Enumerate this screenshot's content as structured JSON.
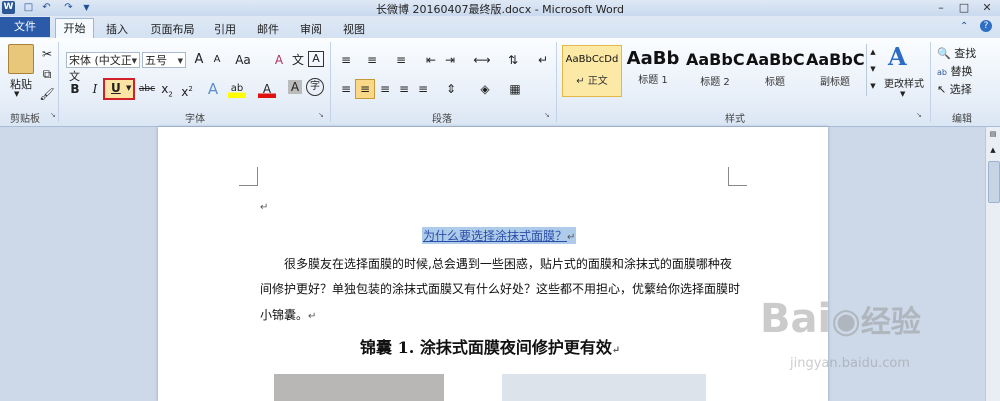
{
  "title_bar": {
    "title": "长微博 20160407最终版.docx - Microsoft Word",
    "app_icon": "W"
  },
  "tabs": [
    "文件",
    "开始",
    "插入",
    "页面布局",
    "引用",
    "邮件",
    "审阅",
    "视图"
  ],
  "ribbon": {
    "clipboard": {
      "paste": "粘贴",
      "group": "剪贴板"
    },
    "font": {
      "font_name": "宋体 (中文正文",
      "font_size": "五号",
      "grow": "A",
      "shrink": "A",
      "change_case": "Aa",
      "clear": "A",
      "pinyin": "文",
      "border": "A",
      "bold": "B",
      "italic": "I",
      "underline": "U",
      "strike": "abc",
      "subscript": "x",
      "superscript": "x",
      "effects": "A",
      "highlight": "ab",
      "font_color": "A",
      "shading": "A",
      "enclose": "字",
      "group": "字体"
    },
    "paragraph": {
      "group": "段落"
    },
    "styles": {
      "items": [
        {
          "sample": "AaBbCcDd",
          "name": "↵ 正文"
        },
        {
          "sample": "AaBb",
          "name": "标题 1"
        },
        {
          "sample": "AaBbC",
          "name": "标题 2"
        },
        {
          "sample": "AaBbC",
          "name": "标题"
        },
        {
          "sample": "AaBbC",
          "name": "副标题"
        }
      ],
      "change_styles": "更改样式",
      "group": "样式"
    },
    "editing": {
      "find": "查找",
      "replace": "替换",
      "select": "选择",
      "group": "编辑"
    }
  },
  "document": {
    "empty_mark": "↵",
    "title": "为什么要选择涂抹式面膜？",
    "title_mark": "↵",
    "body_line1": "很多膜友在选择面膜的时候,总会遇到一些困惑，贴片式的面膜和涂抹式的面膜哪种夜",
    "body_line2": "间修护更好？单独包装的涂抹式面膜又有什么好处？这些都不用担心，优蘩给你选择面膜时",
    "body_line3": "小锦囊。",
    "body_mark": "↵",
    "heading": "锦囊 1. 涂抹式面膜夜间修护更有效",
    "heading_mark": "↵"
  },
  "watermark": {
    "brand": "Bai",
    "brand2": "经验",
    "url": "jingyan.baidu.com"
  },
  "colors": {
    "file_tab": "#2a5aa8",
    "highlight_box": "#d0202a",
    "selection": "#aecbea"
  }
}
